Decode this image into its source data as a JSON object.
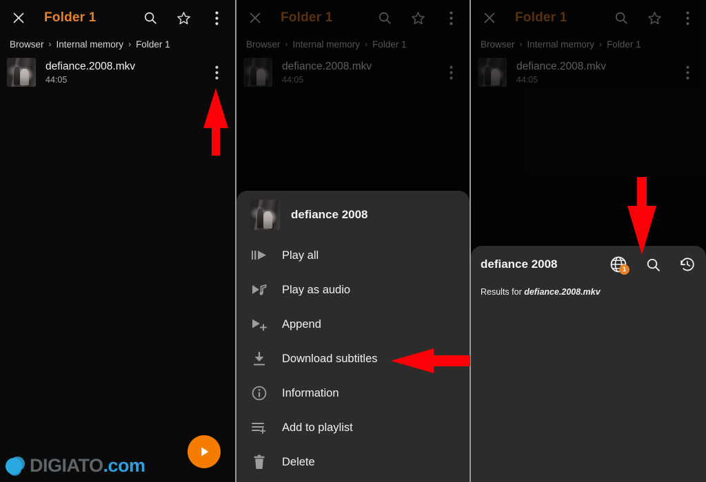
{
  "app": {
    "title": "Folder 1",
    "icons": {
      "close": "close-icon",
      "search": "search-icon",
      "star": "star-icon",
      "overflow": "overflow-menu-icon"
    }
  },
  "breadcrumb": {
    "items": [
      "Browser",
      "Internal memory",
      "Folder 1"
    ],
    "separator": "›"
  },
  "file": {
    "name": "defiance.2008.mkv",
    "duration": "44:05"
  },
  "fab": {
    "label": "play-button"
  },
  "watermark": {
    "name": "DIGIATO",
    "dot": ".",
    "com": "com"
  },
  "sheet": {
    "header_title": "defiance 2008",
    "items": [
      {
        "label": "Play all",
        "icon": "play-all-icon"
      },
      {
        "label": "Play as audio",
        "icon": "play-as-audio-icon"
      },
      {
        "label": "Append",
        "icon": "append-icon"
      },
      {
        "label": "Download subtitles",
        "icon": "download-subtitles-icon"
      },
      {
        "label": "Information",
        "icon": "information-icon"
      },
      {
        "label": "Add to playlist",
        "icon": "add-to-playlist-icon"
      },
      {
        "label": "Delete",
        "icon": "delete-icon"
      }
    ]
  },
  "dialog": {
    "title": "defiance 2008",
    "results_prefix": "Results for ",
    "results_file": "defiance.2008.mkv",
    "globe_badge": "1",
    "icons": {
      "globe": "globe-icon",
      "search": "search-icon",
      "history": "history-icon"
    }
  },
  "colors": {
    "accent": "#e8822a",
    "fab": "#f57c00",
    "arrow": "#fb0007",
    "sheet_bg": "#2c2c2c",
    "page_bg": "#0a0a0a"
  },
  "annotations": [
    {
      "name": "arrow-to-overflow-menu",
      "direction": "up"
    },
    {
      "name": "arrow-to-download-subtitles",
      "direction": "left"
    },
    {
      "name": "arrow-to-globe-icon",
      "direction": "down"
    }
  ]
}
